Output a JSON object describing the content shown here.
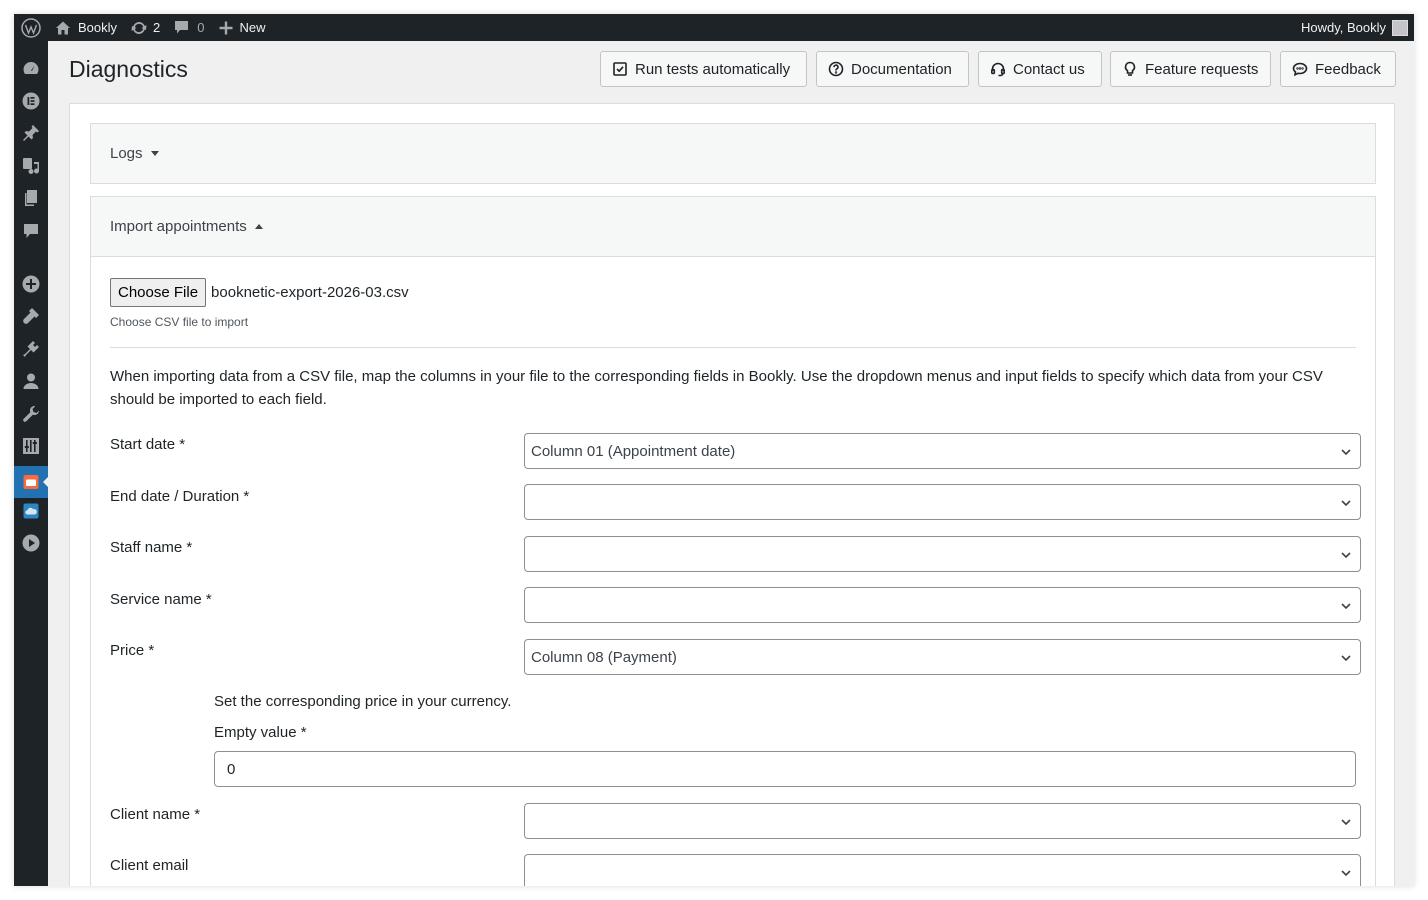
{
  "adminbar": {
    "site_name": "Bookly",
    "updates_count": "2",
    "comments_count": "0",
    "new_label": "New",
    "greeting": "Howdy, Bookly"
  },
  "page": {
    "title": "Diagnostics"
  },
  "toolbar": {
    "run_tests": "Run tests automatically",
    "documentation": "Documentation",
    "contact_us": "Contact us",
    "feature_requests": "Feature requests",
    "feedback": "Feedback"
  },
  "logs_panel": {
    "title": "Logs"
  },
  "import_panel": {
    "title": "Import appointments",
    "choose_file_label": "Choose File",
    "file_name": "booknetic-export-2026-03.csv",
    "file_hint": "Choose CSV file to import",
    "description": "When importing data from a CSV file, map the columns in your file to the corresponding fields in Bookly. Use the dropdown menus and input fields to specify which data from your CSV should be imported to each field.",
    "fields": {
      "start_date": {
        "label": "Start date *",
        "value": "Column 01 (Appointment date)"
      },
      "end_date": {
        "label": "End date / Duration *",
        "value": ""
      },
      "staff_name": {
        "label": "Staff name *",
        "value": ""
      },
      "service_name": {
        "label": "Service name *",
        "value": ""
      },
      "price": {
        "label": "Price *",
        "value": "Column 08 (Payment)"
      },
      "client_name": {
        "label": "Client name *",
        "value": ""
      },
      "client_email": {
        "label": "Client email",
        "value": ""
      }
    },
    "price_note": "Set the corresponding price in your currency.",
    "empty_value_label": "Empty value *",
    "empty_value": "0"
  },
  "sidebar": {
    "items": [
      "dashboard-icon",
      "elementor-icon",
      "posts-icon",
      "media-icon",
      "pages-icon",
      "comments-icon",
      "add-icon",
      "appearance-icon",
      "plugins-icon",
      "users-icon",
      "tools-icon",
      "settings-icon",
      "bookly-icon",
      "cloud-icon",
      "play-icon"
    ],
    "active": "bookly-icon"
  }
}
